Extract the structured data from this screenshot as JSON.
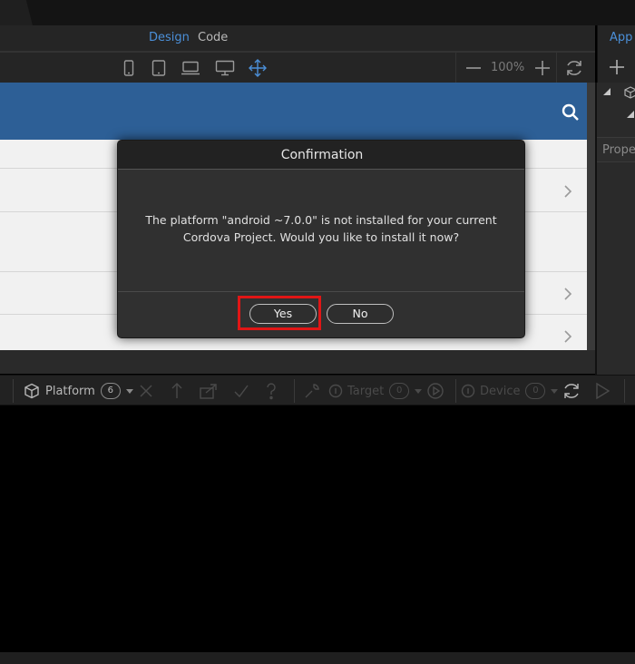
{
  "header": {
    "tabs": [
      "Design",
      "Code"
    ],
    "right_panel_title": "App S"
  },
  "toolbar": {
    "devices": [
      "phone-icon",
      "tablet-icon",
      "laptop-icon",
      "desktop-icon",
      "move-icon"
    ],
    "zoom_level": "100%"
  },
  "right_panel": {
    "properties_label": "Prope"
  },
  "bottom_toolbar": {
    "platform_label": "Platform",
    "platform_count": "6",
    "target_label": "Target",
    "target_count": "0",
    "device_label": "Device",
    "device_count": "0"
  },
  "dialog": {
    "title": "Confirmation",
    "message": "The platform \"android ~7.0.0\" is not installed for your current Cordova Project. Would you like to install it now?",
    "yes_label": "Yes",
    "no_label": "No"
  },
  "colors": {
    "accent": "#4b8fd8",
    "app_bar": "#2d5f96",
    "highlight": "#e01616"
  }
}
